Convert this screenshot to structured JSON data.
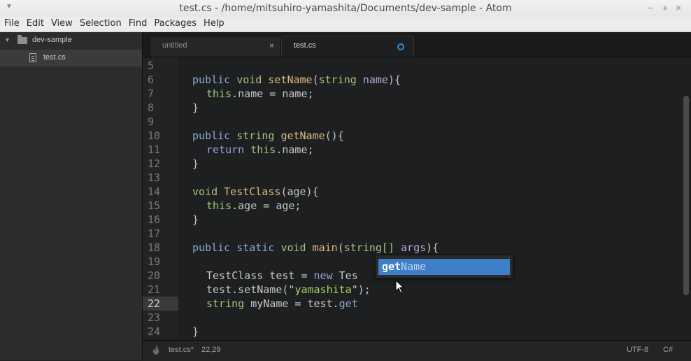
{
  "window": {
    "title": "test.cs - /home/mitsuhiro-yamashita/Documents/dev-sample - Atom",
    "controls": {
      "minimize": "−",
      "maximize": "+",
      "close": "×"
    }
  },
  "menubar": {
    "items": [
      "File",
      "Edit",
      "View",
      "Selection",
      "Find",
      "Packages",
      "Help"
    ]
  },
  "tree": {
    "project": "dev-sample",
    "file": "test.cs",
    "icons": {
      "folder": "folder-icon",
      "file": "file-text-icon"
    }
  },
  "tabs": [
    {
      "label": "untitled",
      "close": "×"
    },
    {
      "label": "test.cs",
      "modified": true
    }
  ],
  "editor": {
    "current_line": 22,
    "line_numbers": [
      "5",
      "6",
      "7",
      "8",
      "9",
      "10",
      "11",
      "12",
      "13",
      "14",
      "15",
      "16",
      "17",
      "18",
      "19",
      "20",
      "21",
      "22",
      "23",
      "24"
    ],
    "lines": {
      "l6": {
        "kw1": "public",
        "ty1": "void",
        "fn": "setName",
        "p1": "(",
        "ty2": "string",
        "pa": "name",
        "p2": "){"
      },
      "l7": {
        "th": "this",
        "rest": ".name = name;"
      },
      "l8": {
        "text": "}"
      },
      "l10": {
        "kw1": "public",
        "ty1": "string",
        "fn": "getName",
        "p2": "(){"
      },
      "l11": {
        "kw": "return",
        "th": "this",
        "rest": ".name;"
      },
      "l12": {
        "text": "}"
      },
      "l14": {
        "ty1": "void",
        "fn": "TestClass",
        "p1": "(age){"
      },
      "l15": {
        "th": "this",
        "rest": ".age = age;"
      },
      "l16": {
        "text": "}"
      },
      "l18": {
        "kw1": "public",
        "kw2": "static",
        "ty1": "void",
        "fn": "main",
        "p1": "(",
        "ty2": "string[]",
        "pa": "args",
        "p2": "){"
      },
      "l20": {
        "pre": "TestClass test = ",
        "kw": "new",
        "post": " Tes"
      },
      "l21": {
        "pre": "test.setName(\"",
        "st": "yamashita",
        "post": "\");"
      },
      "l22": {
        "ty": "string",
        "pre": " myName = test.",
        "typed": "get"
      },
      "l24": {
        "text": "}"
      }
    }
  },
  "autocomplete": {
    "match": "get",
    "rest": "Name"
  },
  "statusbar": {
    "file": "test.cs*",
    "position": "22,29",
    "encoding": "UTF-8",
    "grammar": "C#"
  },
  "colors": {
    "accent": "#3f7fc9",
    "modified_dot": "#2e8fd9"
  }
}
